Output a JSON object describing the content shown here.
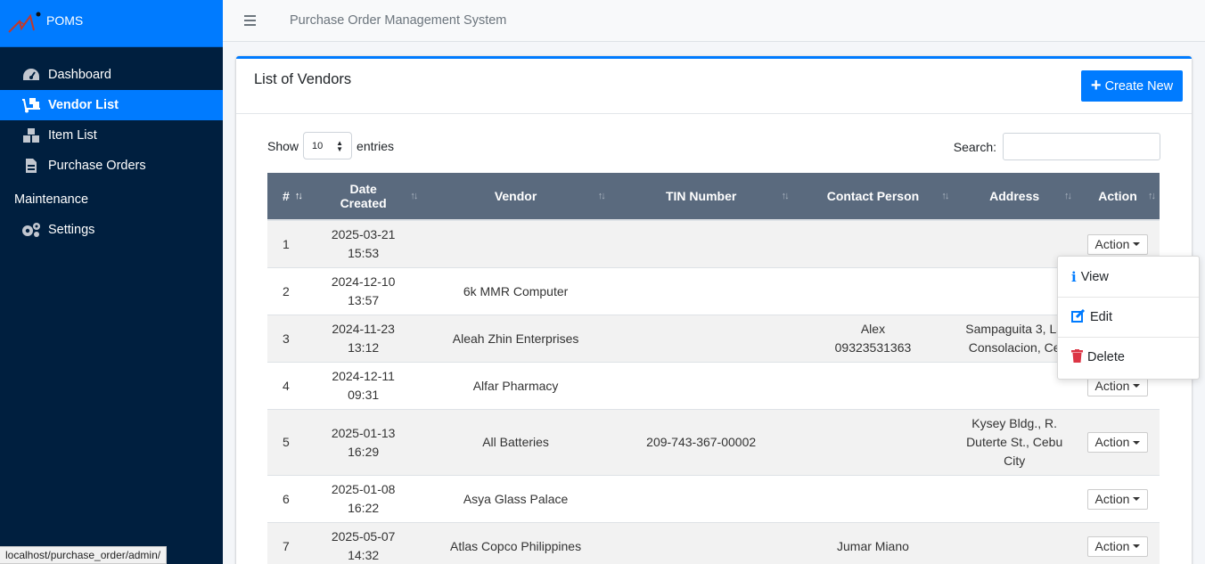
{
  "brand": {
    "name": "POMS"
  },
  "sidebar": {
    "items": [
      {
        "label": "Dashboard",
        "icon": "tachometer-icon"
      },
      {
        "label": "Vendor List",
        "icon": "truck-loading-icon",
        "active": true
      },
      {
        "label": "Item List",
        "icon": "boxes-icon"
      },
      {
        "label": "Purchase Orders",
        "icon": "file-invoice-icon"
      }
    ],
    "section_header": "Maintenance",
    "settings": {
      "label": "Settings",
      "icon": "cogs-icon"
    }
  },
  "topbar": {
    "title": "Purchase Order Management System"
  },
  "card": {
    "title": "List of Vendors",
    "create_label": "Create New"
  },
  "controls": {
    "show_label": "Show",
    "page_size": "10",
    "entries_label": "entries",
    "search_label": "Search:",
    "search_value": ""
  },
  "table": {
    "columns": [
      "#",
      "Date Created",
      "Vendor",
      "TIN Number",
      "Contact Person",
      "Address",
      "Action"
    ],
    "rows": [
      {
        "no": "1",
        "date": "2025-03-21",
        "time": "15:53",
        "vendor": "",
        "tin": "",
        "contact1": "",
        "contact2": "",
        "addr1": "",
        "addr2": "",
        "addr3": "",
        "action": "Action"
      },
      {
        "no": "2",
        "date": "2024-12-10",
        "time": "13:57",
        "vendor": "6k MMR Computer",
        "tin": "",
        "contact1": "",
        "contact2": "",
        "addr1": "",
        "addr2": "",
        "addr3": "",
        "action": "Action"
      },
      {
        "no": "3",
        "date": "2024-11-23",
        "time": "13:12",
        "vendor": "Aleah Zhin Enterprises",
        "tin": "",
        "contact1": "Alex",
        "contact2": "09323531363",
        "addr1": "Sampaguita 3, La",
        "addr2": "Consolacion, Ce",
        "addr3": "",
        "action": "Action"
      },
      {
        "no": "4",
        "date": "2024-12-11",
        "time": "09:31",
        "vendor": "Alfar Pharmacy",
        "tin": "",
        "contact1": "",
        "contact2": "",
        "addr1": "",
        "addr2": "",
        "addr3": "",
        "action": "Action"
      },
      {
        "no": "5",
        "date": "2025-01-13",
        "time": "16:29",
        "vendor": "All Batteries",
        "tin": "209-743-367-00002",
        "contact1": "",
        "contact2": "",
        "addr1": "Kysey Bldg., R.",
        "addr2": "Duterte St., Cebu",
        "addr3": "City",
        "action": "Action"
      },
      {
        "no": "6",
        "date": "2025-01-08",
        "time": "16:22",
        "vendor": "Asya Glass Palace",
        "tin": "",
        "contact1": "",
        "contact2": "",
        "addr1": "",
        "addr2": "",
        "addr3": "",
        "action": "Action"
      },
      {
        "no": "7",
        "date": "2025-05-07",
        "time": "14:32",
        "vendor": "Atlas Copco Philippines",
        "tin": "",
        "contact1": "Jumar Miano",
        "contact2": "",
        "addr1": "",
        "addr2": "",
        "addr3": "",
        "action": "Action"
      }
    ]
  },
  "dropdown": {
    "items": [
      {
        "label": "View",
        "icon": "info-icon",
        "color": "#007bff"
      },
      {
        "label": "Edit",
        "icon": "edit-icon",
        "color": "#007bff"
      },
      {
        "label": "Delete",
        "icon": "trash-icon",
        "color": "#dc3545"
      }
    ]
  },
  "statusbar": {
    "url": "localhost/purchase_order/admin/"
  },
  "colors": {
    "primary": "#007bff",
    "sidebar": "#001f3f",
    "table_header": "#5a6a7e",
    "danger": "#dc3545"
  }
}
